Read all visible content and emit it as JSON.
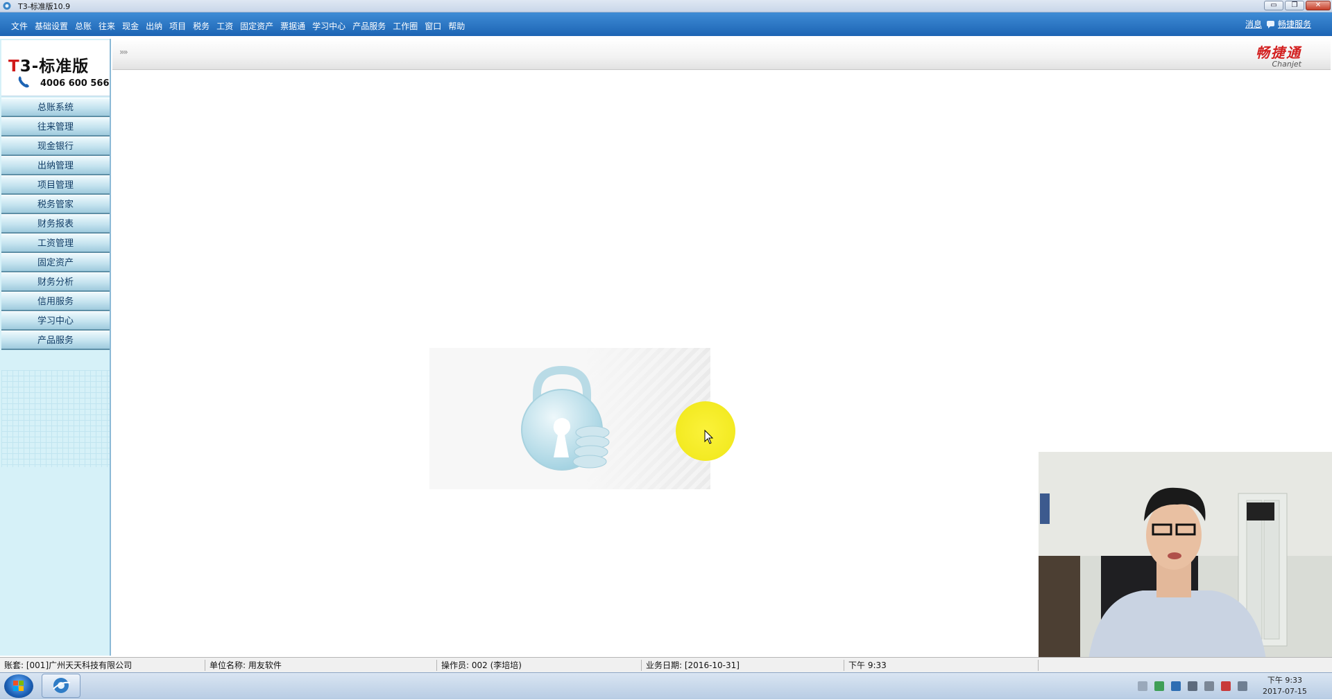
{
  "window": {
    "title": "T3-标准版10.9",
    "minimize_label": "▭",
    "maximize_label": "❐",
    "close_label": "✕"
  },
  "menu": {
    "items": [
      "文件",
      "基础设置",
      "总账",
      "往来",
      "现金",
      "出纳",
      "项目",
      "税务",
      "工资",
      "固定资产",
      "票据通",
      "学习中心",
      "产品服务",
      "工作圈",
      "窗口",
      "帮助"
    ],
    "message_label": "消息",
    "service_label": "畅捷服务"
  },
  "sidebar": {
    "logo_prefix": "T",
    "logo_text": "3-标准版",
    "phone": "4006 600 566",
    "items": [
      "总账系统",
      "往来管理",
      "现金银行",
      "出纳管理",
      "项目管理",
      "税务管家",
      "财务报表",
      "工资管理",
      "固定资产",
      "财务分析",
      "信用服务",
      "学习中心",
      "产品服务"
    ]
  },
  "header": {
    "expand_glyph": "»»",
    "brand_cn": "畅捷通",
    "brand_en": "Chanjet"
  },
  "statusbar": {
    "account": "账套: [001]广州天天科技有限公司",
    "unit": "单位名称: 用友软件",
    "operator": "操作员: 002 (李培培)",
    "business_date": "业务日期: [2016-10-31]",
    "time": "下午 9:33"
  },
  "taskbar": {
    "clock_time": "下午 9:33",
    "clock_date": "2017-07-15",
    "tray_icons": [
      "keyboard-icon",
      "pen-icon",
      "ime-icon",
      "tools-icon",
      "device-icon",
      "network-icon",
      "volume-icon"
    ]
  },
  "colors": {
    "menubar": "#1d64b4",
    "sidebar_bg": "#d6f1f8",
    "brand_red": "#d32020",
    "cursor_highlight": "#f3ea22"
  }
}
